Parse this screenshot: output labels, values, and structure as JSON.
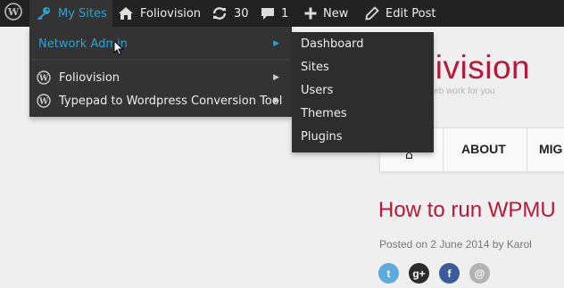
{
  "admin_bar": {
    "my_sites_label": "My Sites",
    "site_name": "Foliovision",
    "updates_count": "30",
    "comments_count": "1",
    "new_label": "New",
    "edit_post_label": "Edit Post"
  },
  "my_sites_menu": {
    "network_admin_label": "Network Admin",
    "sites": [
      {
        "label": "Foliovision"
      },
      {
        "label": "Typepad to Wordpress Conversion Tool"
      }
    ]
  },
  "network_admin_submenu": {
    "items": [
      {
        "label": "Dashboard"
      },
      {
        "label": "Sites"
      },
      {
        "label": "Users"
      },
      {
        "label": "Themes"
      },
      {
        "label": "Plugins"
      }
    ]
  },
  "page": {
    "brand_text": "olivision",
    "tagline": "web work for you",
    "nav_items": [
      {
        "label": "ABOUT"
      },
      {
        "label": "MIG"
      }
    ],
    "post_title": "How to run WPMU",
    "post_meta": "Posted on 2 June 2014 by Karol",
    "share": {
      "twitter": "t",
      "googleplus": "g+",
      "facebook": "f",
      "email": "@"
    }
  },
  "colors": {
    "admin_bar_bg": "#222222",
    "accent_blue": "#2ea2cc",
    "brand_red": "#b8193a"
  }
}
